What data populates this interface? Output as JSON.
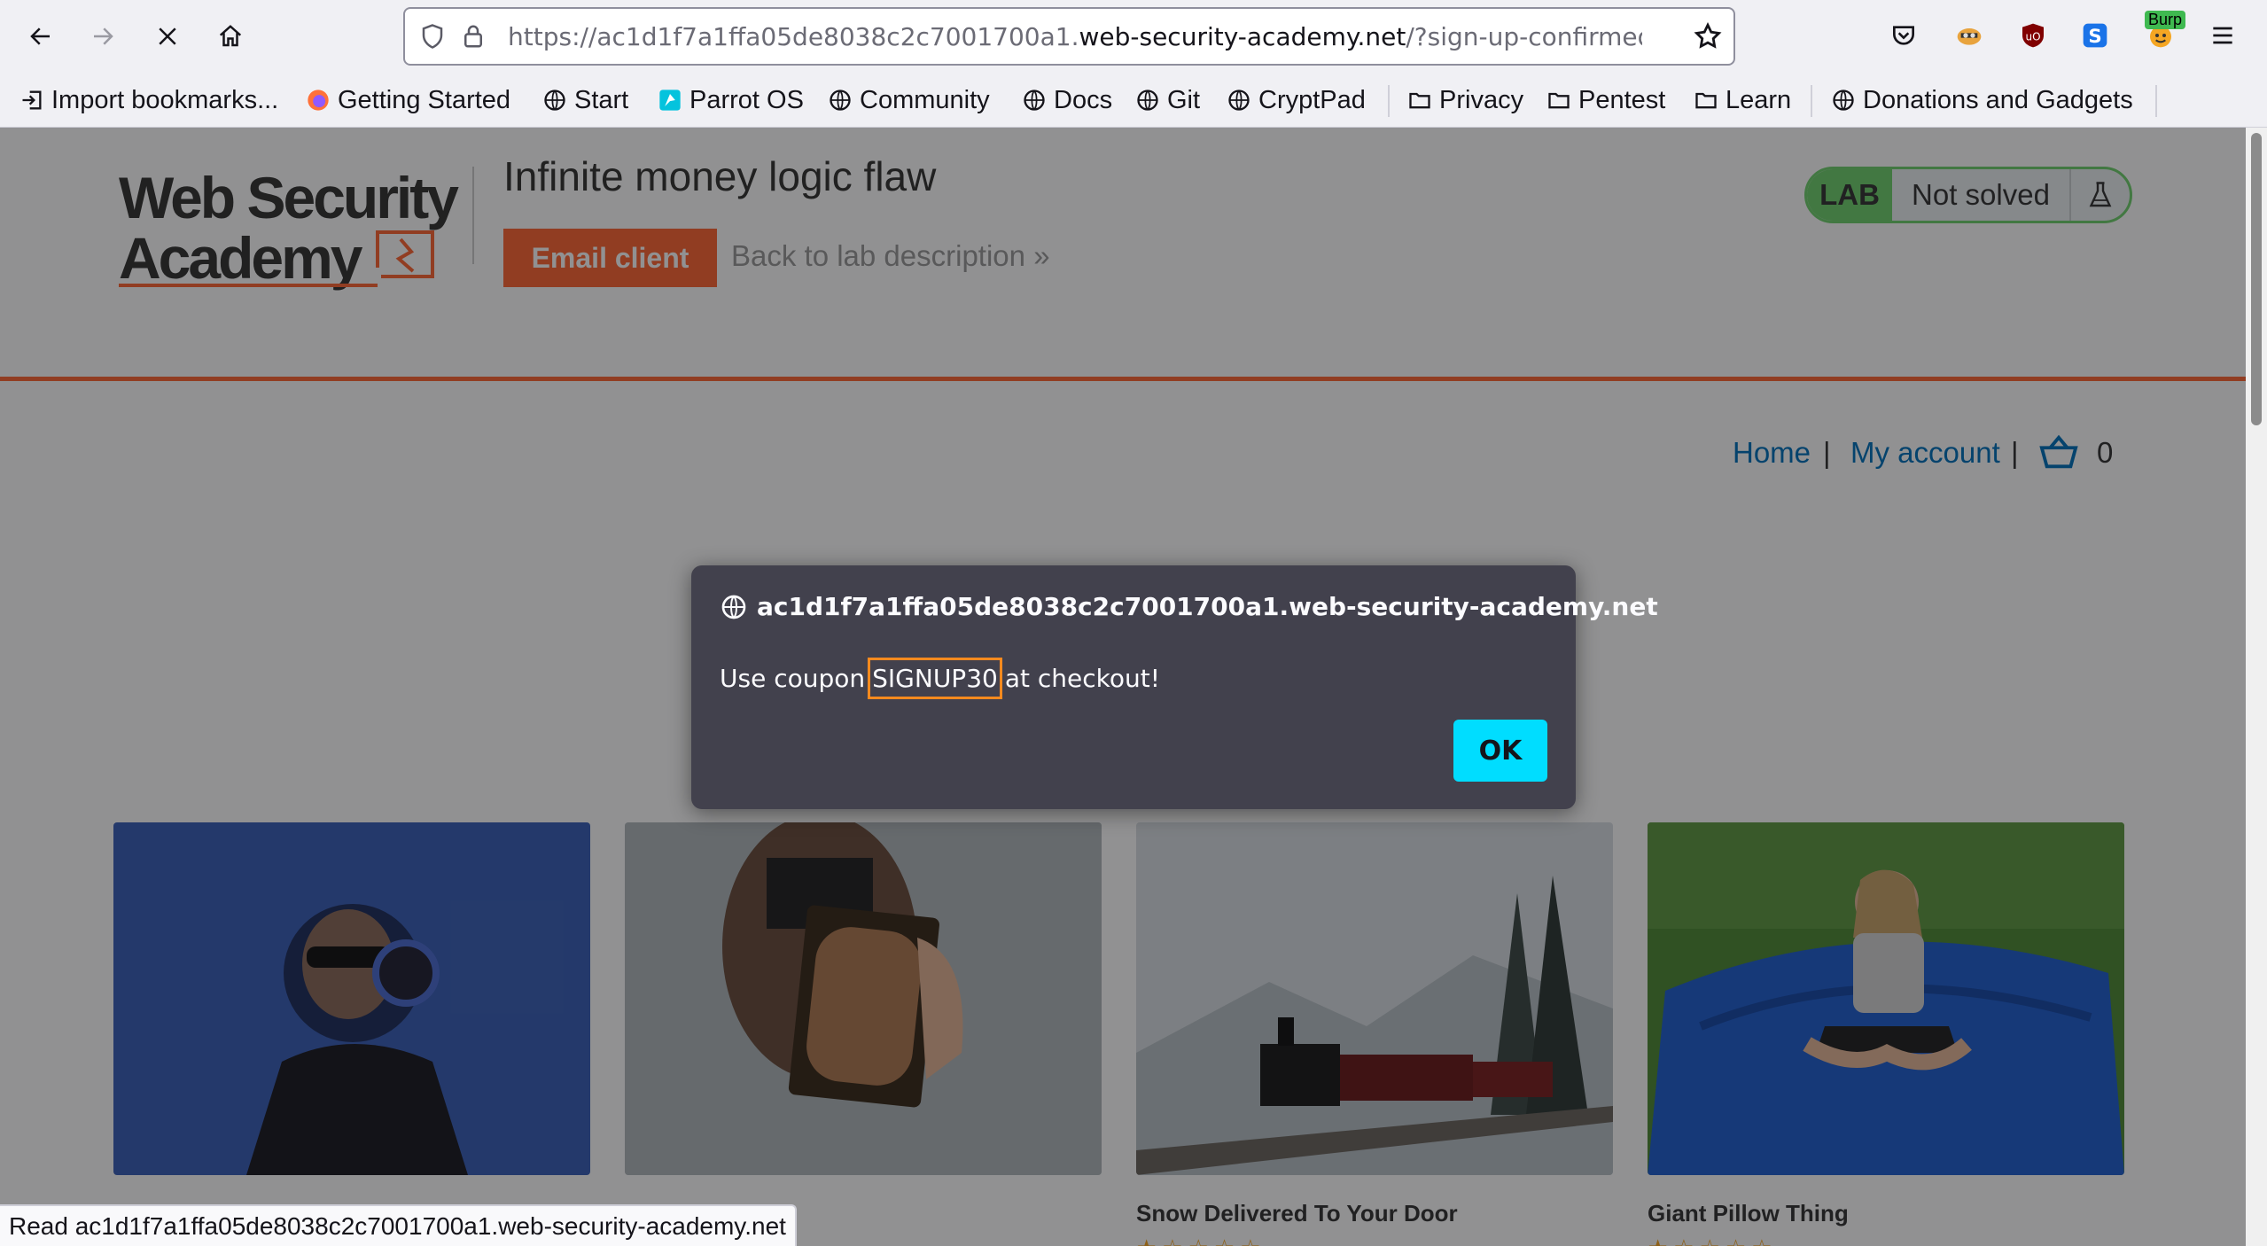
{
  "browser": {
    "url_prefix": "https://ac1d1f7a1ffa05de8038c2c7001700a1.",
    "url_domain": "web-security-academy.net",
    "url_suffix": "/?sign-up-confirmed=tr",
    "extensions": [
      "pocket-icon",
      "foxyproxy-icon",
      "ublock-origin-icon",
      "s-extension-icon",
      "burp-icon"
    ],
    "burp_badge": "Burp"
  },
  "bookmarks": [
    {
      "label": "Import bookmarks...",
      "icon": "import-icon"
    },
    {
      "label": "Getting Started",
      "icon": "firefox-icon"
    },
    {
      "label": "Start",
      "icon": "globe-icon"
    },
    {
      "label": "Parrot OS",
      "icon": "parrot-icon"
    },
    {
      "label": "Community",
      "icon": "globe-icon"
    },
    {
      "label": "Docs",
      "icon": "globe-icon"
    },
    {
      "label": "Git",
      "icon": "globe-icon"
    },
    {
      "label": "CryptPad",
      "icon": "globe-icon"
    },
    {
      "label": "Privacy",
      "icon": "folder-icon"
    },
    {
      "label": "Pentest",
      "icon": "folder-icon"
    },
    {
      "label": "Learn",
      "icon": "folder-icon"
    },
    {
      "label": "Donations and Gadgets",
      "icon": "globe-icon"
    }
  ],
  "lab": {
    "logo_line1": "Web Security",
    "logo_line2": "Academy",
    "title": "Infinite money logic flaw",
    "email_button": "Email client",
    "back_link": "Back to lab description",
    "badge": "LAB",
    "status": "Not solved"
  },
  "nav": {
    "home": "Home",
    "account": "My account",
    "separator": "|",
    "cart_count": "0"
  },
  "products": [
    {
      "name": ""
    },
    {
      "name": ""
    },
    {
      "name": "Snow Delivered To Your Door"
    },
    {
      "name": "Giant Pillow Thing"
    }
  ],
  "dialog": {
    "origin": "ac1d1f7a1ffa05de8038c2c7001700a1.web-security-academy.net",
    "message_before": "Use coupon",
    "coupon": "SIGNUP30",
    "message_after": "at checkout!",
    "ok": "OK"
  },
  "status_bar": "Read ac1d1f7a1ffa05de8038c2c7001700a1.web-security-academy.net",
  "colors": {
    "accent": "#ff6633",
    "link": "#0071bc",
    "lab_green": "#70d16d",
    "dialog_bg": "#42414d",
    "ok_button": "#00ddff",
    "coupon_highlight": "#ff8a1e"
  }
}
